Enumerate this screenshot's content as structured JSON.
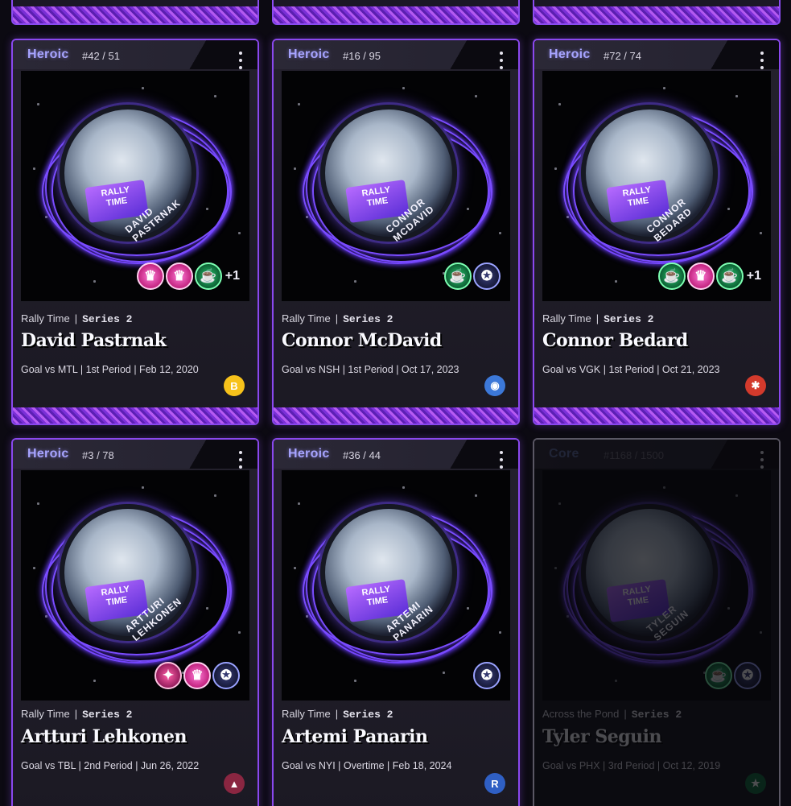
{
  "cards": [
    {
      "tier": "Heroic",
      "serial": "#42 / 51",
      "set": "Rally Time",
      "series": "Series 2",
      "player": "David Pastrnak",
      "play": "Goal vs MTL | 1st Period | Feb 12, 2020",
      "puck_label": "DAVID PASTRNAK",
      "badges": [
        "pink",
        "pink",
        "green"
      ],
      "extra": "+1",
      "team_icon": "bruins-logo-icon",
      "team_glyph": "B",
      "team_color": "#f7c21b"
    },
    {
      "tier": "Heroic",
      "serial": "#16 / 95",
      "set": "Rally Time",
      "series": "Series 2",
      "player": "Connor McDavid",
      "play": "Goal vs NSH | 1st Period | Oct 17, 2023",
      "puck_label": "CONNOR MCDAVID",
      "badges": [
        "green",
        "blue"
      ],
      "extra": "",
      "team_icon": "oilers-logo-icon",
      "team_glyph": "◉",
      "team_color": "#3c78d8"
    },
    {
      "tier": "Heroic",
      "serial": "#72 / 74",
      "set": "Rally Time",
      "series": "Series 2",
      "player": "Connor Bedard",
      "play": "Goal vs VGK | 1st Period | Oct 21, 2023",
      "puck_label": "CONNOR BEDARD",
      "badges": [
        "green",
        "pink",
        "green"
      ],
      "extra": "+1",
      "team_icon": "blackhawks-logo-icon",
      "team_glyph": "✱",
      "team_color": "#d33a2c"
    },
    {
      "tier": "Heroic",
      "serial": "#3 / 78",
      "set": "Rally Time",
      "series": "Series 2",
      "player": "Artturi Lehkonen",
      "play": "Goal vs TBL | 2nd Period | Jun 26, 2022",
      "puck_label": "ARTTURI LEHKONEN",
      "badges": [
        "pinkstar",
        "pink",
        "blue"
      ],
      "extra": "",
      "team_icon": "avalanche-logo-icon",
      "team_glyph": "▲",
      "team_color": "#8a2641"
    },
    {
      "tier": "Heroic",
      "serial": "#36 / 44",
      "set": "Rally Time",
      "series": "Series 2",
      "player": "Artemi Panarin",
      "play": "Goal vs NYI | Overtime | Feb 18, 2024",
      "puck_label": "ARTEMI PANARIN",
      "badges": [
        "blue"
      ],
      "extra": "",
      "team_icon": "rangers-logo-icon",
      "team_glyph": "R",
      "team_color": "#2f5fc4"
    },
    {
      "tier": "Core",
      "serial": "#1168 / 1500",
      "set": "Across the Pond",
      "series": "Series 2",
      "player": "Tyler Seguin",
      "play": "Goal vs PHX | 3rd Period | Oct 12, 2019",
      "puck_label": "TYLER SEGUIN",
      "badges": [
        "green",
        "blue"
      ],
      "extra": "",
      "team_icon": "stars-logo-icon",
      "team_glyph": "★",
      "team_color": "#0c6b3a"
    }
  ]
}
